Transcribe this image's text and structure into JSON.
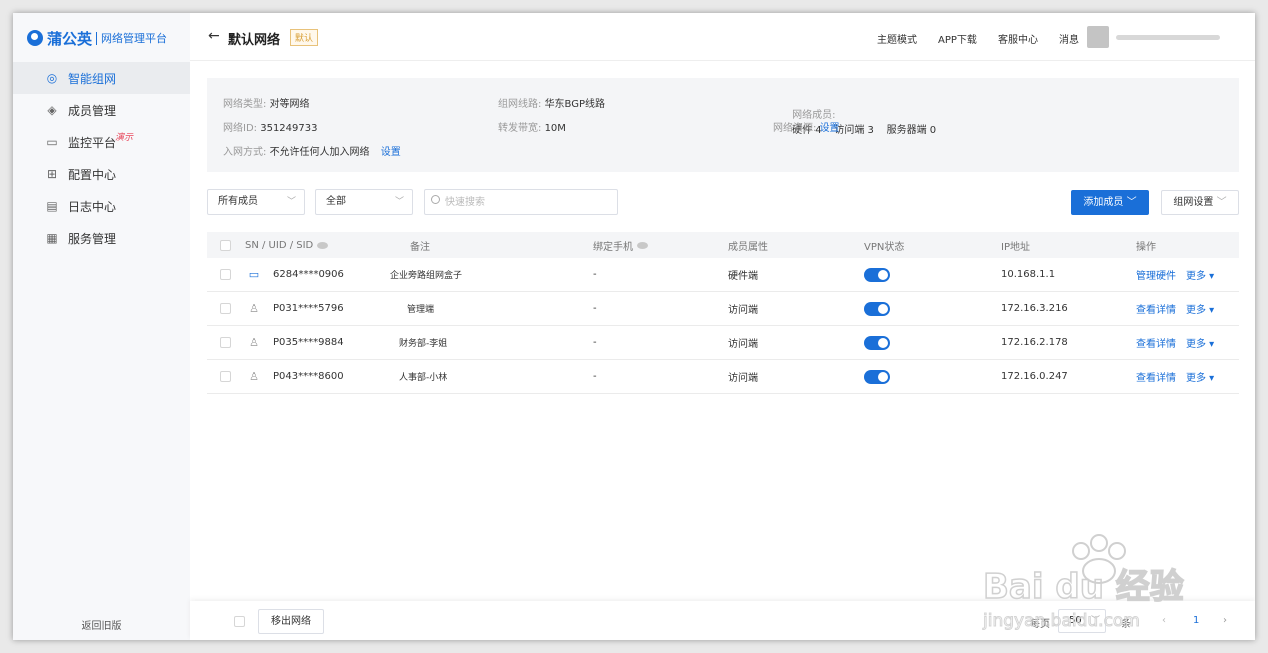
{
  "brand": {
    "name": "蒲公英",
    "subtitle": "网络管理平台",
    "color": "#1a6fd8"
  },
  "sidebar": {
    "items": [
      {
        "label": "智能组网",
        "icon": "network-icon",
        "active": true
      },
      {
        "label": "成员管理",
        "icon": "layers-icon"
      },
      {
        "label": "监控平台",
        "icon": "monitor-icon",
        "badge": "演示"
      },
      {
        "label": "配置中心",
        "icon": "grid-icon"
      },
      {
        "label": "日志中心",
        "icon": "log-icon"
      },
      {
        "label": "服务管理",
        "icon": "service-icon"
      }
    ],
    "back_old": "返回旧版"
  },
  "header": {
    "back_arrow": "←",
    "title": "默认网络",
    "tag": "默认",
    "links": [
      "主题模式",
      "APP下载",
      "客服中心",
      "消息"
    ]
  },
  "info": {
    "network_type": {
      "label": "网络类型:",
      "value": "对等网络"
    },
    "network_id": {
      "label": "网络ID:",
      "value": "351249733"
    },
    "join_mode": {
      "label": "入网方式:",
      "value": "不允许任何人加入网络",
      "link": "设置"
    },
    "route": {
      "label": "组网线路:",
      "value": "华东BGP线路"
    },
    "bandwidth": {
      "label": "转发带宽:",
      "value": "10M"
    },
    "members": {
      "label": "网络成员:",
      "value": "硬件 4    访问端 3    服务器端 0"
    },
    "resources": {
      "label": "网络资源:",
      "link": "设置"
    }
  },
  "filters": {
    "member_scope": "所有成员",
    "status": "全部",
    "search_placeholder": "快速搜索",
    "add_member": "添加成员",
    "network_settings": "组网设置"
  },
  "table": {
    "headers": [
      "SN / UID / SID",
      "备注",
      "绑定手机",
      "成员属性",
      "VPN状态",
      "IP地址",
      "操作"
    ],
    "rows": [
      {
        "id": "6284****0906",
        "note": "企业旁路组网盒子",
        "phone": "-",
        "type": "硬件端",
        "vpn_on": true,
        "ip": "10.168.1.1",
        "action": "管理硬件",
        "more": "更多 ▾",
        "icon": "hardware-icon"
      },
      {
        "id": "P031****5796",
        "note": "管理端",
        "phone": "-",
        "type": "访问端",
        "vpn_on": true,
        "ip": "172.16.3.216",
        "action": "查看详情",
        "more": "更多 ▾",
        "icon": "user-icon"
      },
      {
        "id": "P035****9884",
        "note": "财务部-李姐",
        "phone": "-",
        "type": "访问端",
        "vpn_on": true,
        "ip": "172.16.2.178",
        "action": "查看详情",
        "more": "更多 ▾",
        "icon": "user-icon"
      },
      {
        "id": "P043****8600",
        "note": "人事部-小林",
        "phone": "-",
        "type": "访问端",
        "vpn_on": true,
        "ip": "172.16.0.247",
        "action": "查看详情",
        "more": "更多 ▾",
        "icon": "user-icon"
      }
    ]
  },
  "footer": {
    "remove": "移出网络",
    "per_page_prefix": "每页",
    "per_page": "50",
    "per_page_suffix": "条",
    "current_page": "1"
  },
  "watermark": {
    "text": "Bai du 经验",
    "url": "jingyan.baidu.com"
  }
}
